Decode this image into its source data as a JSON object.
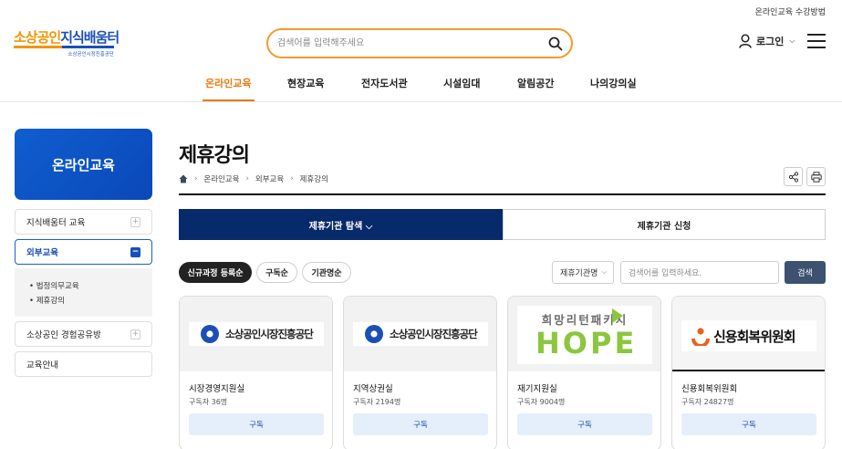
{
  "header": {
    "util_link": "온라인교육 수강방법",
    "logo": {
      "main_orange": "소상공인",
      "main_blue": "지식배움터",
      "sub": "소상공인시장진흥공단"
    },
    "search_placeholder": "검색어를 입력해주세요",
    "login_label": "로그인"
  },
  "gnb": [
    {
      "label": "온라인교육",
      "active": true
    },
    {
      "label": "현장교육"
    },
    {
      "label": "전자도서관"
    },
    {
      "label": "시설임대"
    },
    {
      "label": "알림공간"
    },
    {
      "label": "나의강의실"
    }
  ],
  "sidebar": {
    "title": "온라인교육",
    "menu": [
      {
        "label": "지식배움터 교육",
        "toggle": "+"
      },
      {
        "label": "외부교육",
        "toggle": "−",
        "active": true
      },
      {
        "label": "소상공인 경험공유방",
        "toggle": "+"
      },
      {
        "label": "교육안내"
      }
    ],
    "submenu": [
      "• 법정의무교육",
      "• 제휴강의"
    ]
  },
  "page": {
    "title": "제휴강의",
    "breadcrumb": [
      "온라인교육",
      "외부교육",
      "제휴강의"
    ]
  },
  "tabs": [
    {
      "label": "제휴기관 탐색 ⌵",
      "active": true
    },
    {
      "label": "제휴기관 신청"
    }
  ],
  "filters": {
    "sort_pills": [
      {
        "label": "신규과정 등록순",
        "active": true
      },
      {
        "label": "구독순"
      },
      {
        "label": "기관명순"
      }
    ],
    "select_value": "제휴기관명",
    "keyword_placeholder": "검색어를 입력하세요.",
    "search_button": "검색"
  },
  "cards": [
    {
      "logo_text": "소상공인시장진흥공단",
      "name": "시장경영지원실",
      "subscribers": "구독자 36명",
      "button": "구독"
    },
    {
      "logo_text": "소상공인시장진흥공단",
      "name": "지역상권실",
      "subscribers": "구독자 2194명",
      "button": "구독"
    },
    {
      "logo_text": "희망리턴패키지",
      "logo_big": "HOPE",
      "name": "재기지원실",
      "subscribers": "구독자 9004명",
      "button": "구독"
    },
    {
      "logo_text": "신용회복위원회",
      "name": "신용회복위원회",
      "subscribers": "구독자 24827명",
      "button": "구독"
    }
  ]
}
